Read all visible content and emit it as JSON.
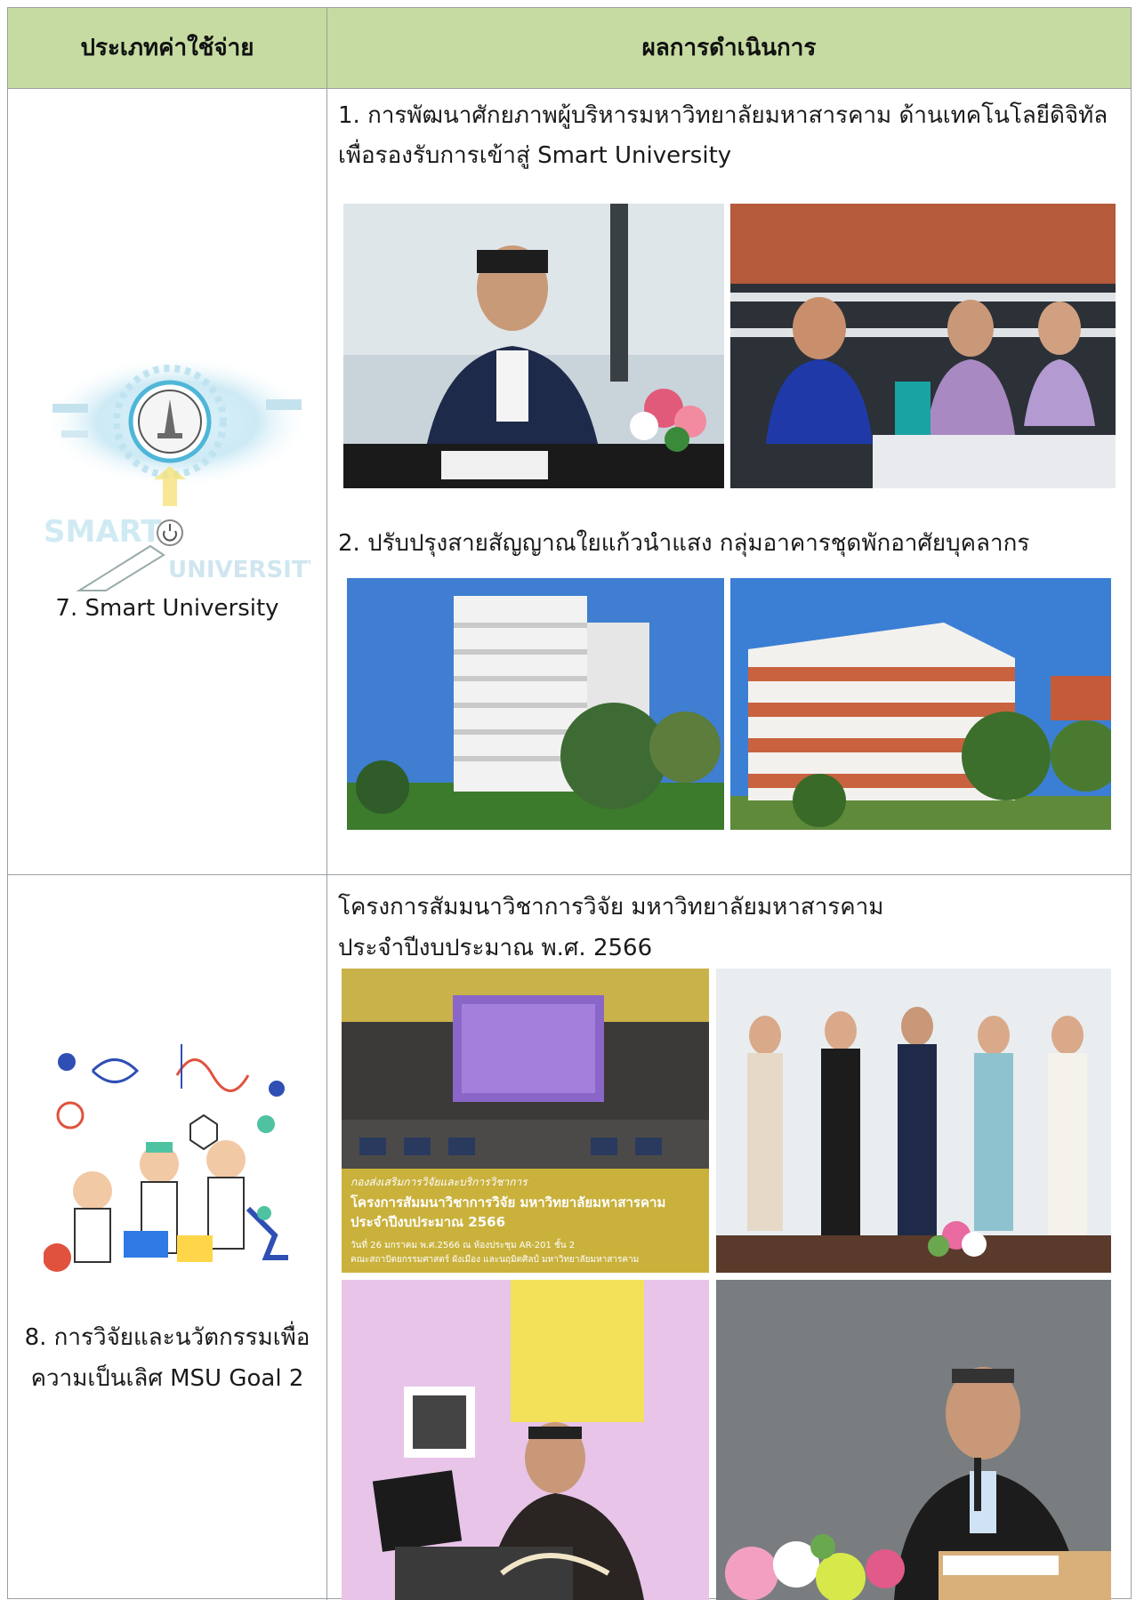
{
  "header": {
    "col1": "ประเภทค่าใช้จ่าย",
    "col2": "ผลการดำเนินการ"
  },
  "row7": {
    "category": "7. Smart University",
    "illustration": {
      "icon": "smart-university-illustration",
      "word1": "SMART",
      "word2": "UNIVERSITY"
    },
    "item1_line1": "1. การพัฒนาศักยภาพผู้บริหารมหาวิทยาลัยมหาสารคาม ด้านเทคโนโลยีดิจิทัล",
    "item1_line2": "เพื่อรองรับการเข้าสู่ Smart University",
    "item2": "2. ปรับปรุงสายสัญญาณใยแก้วนำแสง กลุ่มอาคารชุดพักอาศัยบุคลากร"
  },
  "row8": {
    "category_line1": "8. การวิจัยและนวัตกรรมเพื่อ",
    "category_line2": "ความเป็นเลิศ  MSU Goal 2",
    "illustration_icon": "research-scientists-illustration",
    "title_line1": "โครงการสัมมนาวิชาการวิจัย มหาวิทยาลัยมหาสารคาม",
    "title_line2": "ประจำปีงบประมาณ พ.ศ. 2566",
    "banner": {
      "tag": "กองส่งเสริมการวิจัยและบริการวิชาการ",
      "title1": "โครงการสัมมนาวิชาการวิจัย มหาวิทยาลัยมหาสารคาม",
      "title2": "ประจำปีงบประมาณ 2566",
      "detail1": "วันที่ 26 มกราคม พ.ศ.2566 ณ ห้องประชุม AR-201 ชั้น 2",
      "detail2": "คณะสถาปัตยกรรมศาสตร์ ผังเมือง และนฤมิตศิลป์ มหาวิทยาลัยมหาสารคาม"
    }
  }
}
